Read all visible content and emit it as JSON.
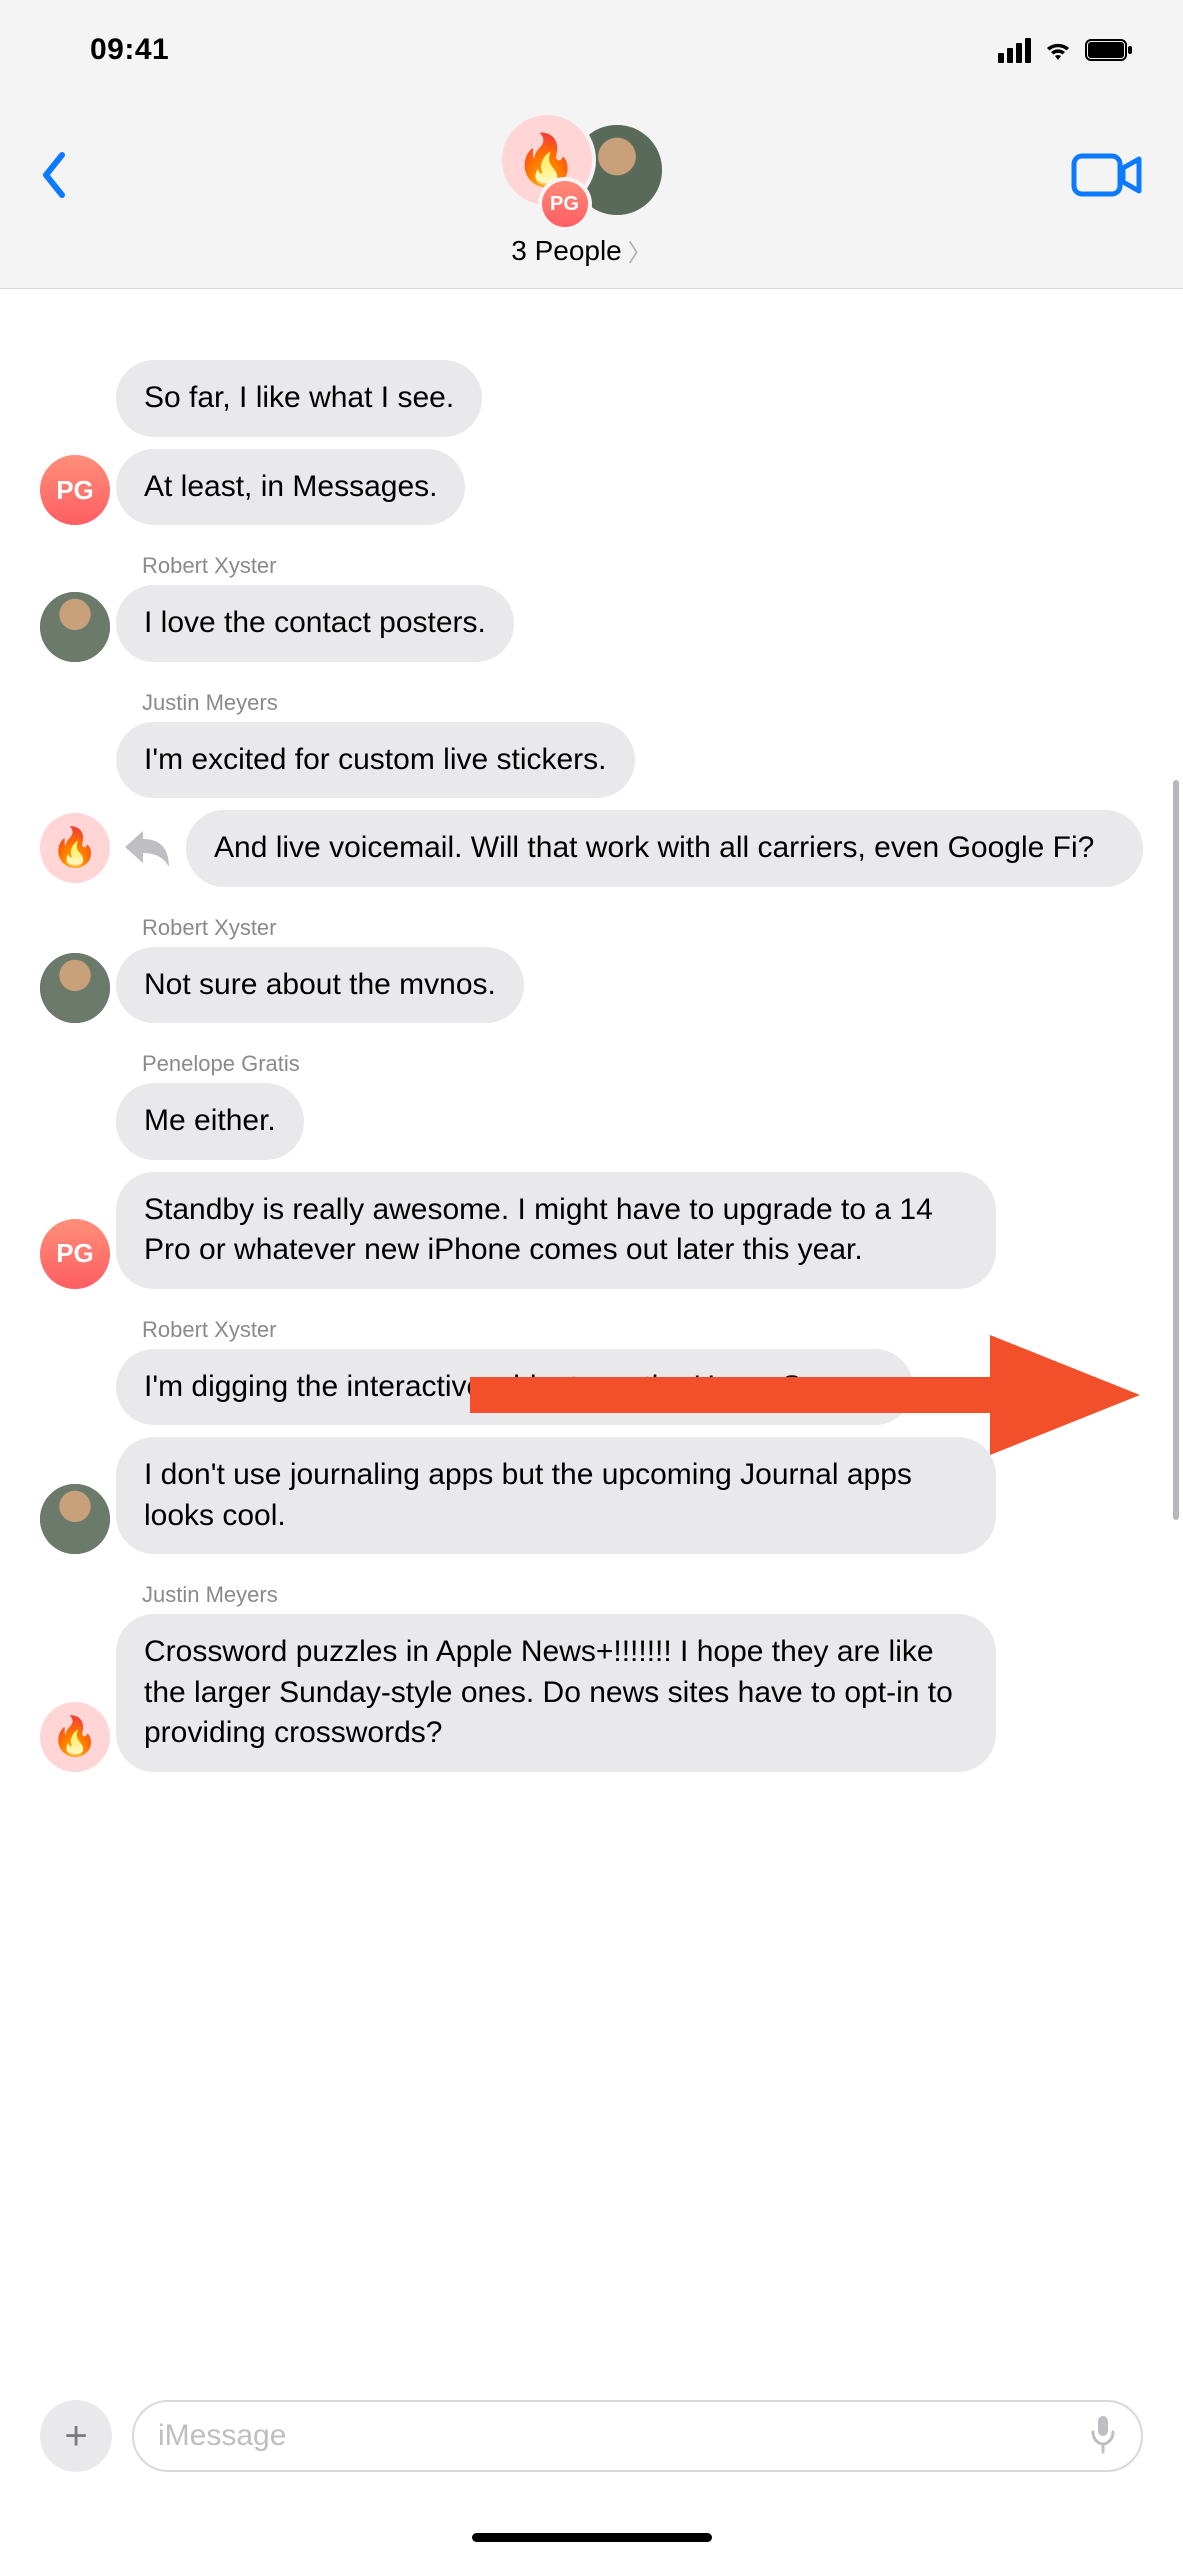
{
  "status": {
    "time": "09:41"
  },
  "header": {
    "title": "3 People",
    "avatar_small_initials": "PG",
    "avatar_fire_emoji": "🔥"
  },
  "senders": {
    "robert": "Robert Xyster",
    "justin": "Justin Meyers",
    "penelope": "Penelope Gratis",
    "pg_initials": "PG",
    "fire_emoji": "🔥"
  },
  "messages": {
    "m1": "So far, I like what I see.",
    "m2": "At least, in Messages.",
    "m3": "I love the contact posters.",
    "m4": "I'm excited for custom live stickers.",
    "m5": "And live voicemail. Will that work with all carriers, even Google Fi?",
    "m6": "Not sure about the mvnos.",
    "m7": "Me either.",
    "m8": "Standby is really awesome. I might have to upgrade to a 14 Pro or whatever new iPhone comes out later this year.",
    "m9": "I'm digging the interactive widgets on the Home Screen.",
    "m10": "I don't use journaling apps but the upcoming Journal apps looks cool.",
    "m11": "Crossword puzzles in Apple News+!!!!!!! I hope they are like the larger Sunday-style ones. Do news sites have to opt-in to providing crosswords?"
  },
  "input": {
    "placeholder": "iMessage"
  }
}
